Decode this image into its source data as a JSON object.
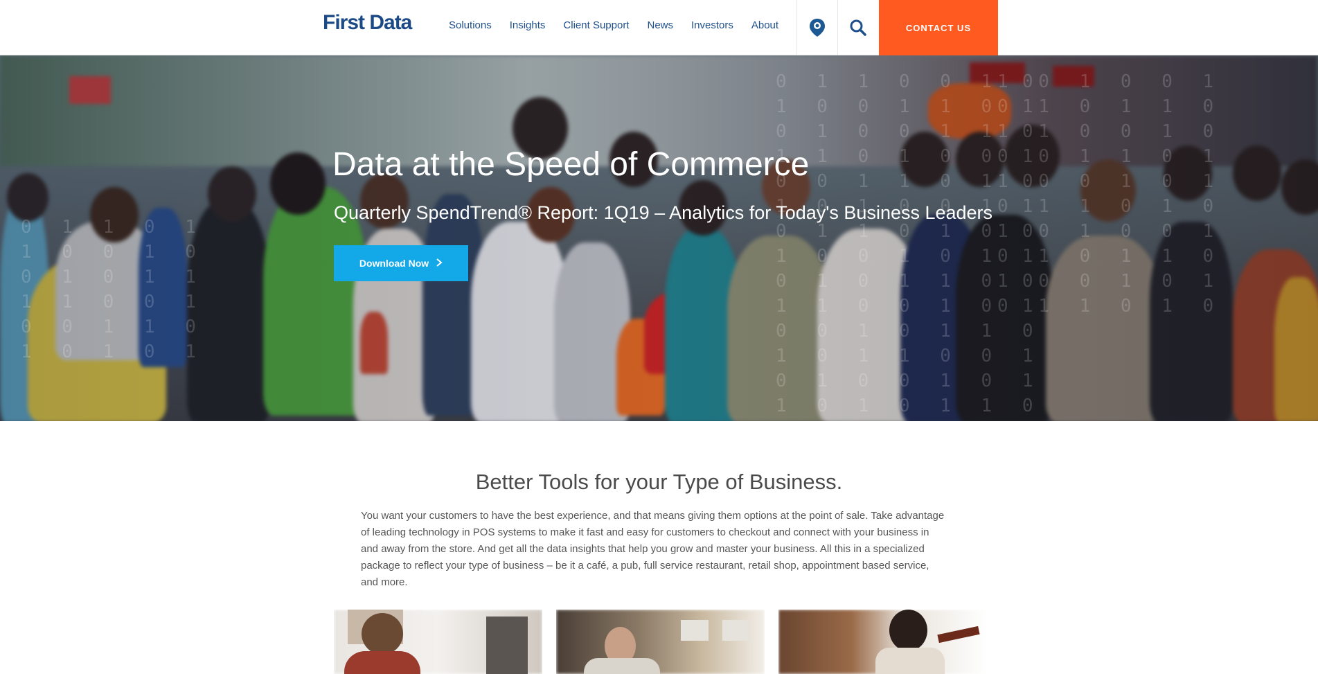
{
  "header": {
    "logo": "First Data",
    "nav": [
      "Solutions",
      "Insights",
      "Client Support",
      "News",
      "Investors",
      "About"
    ],
    "contact_label": "CONTACT US",
    "location_icon": "location-pin-icon",
    "search_icon": "search-icon"
  },
  "hero": {
    "title": "Data at the Speed of Commerce",
    "subtitle": "Quarterly SpendTrend® Report: 1Q19 – Analytics for Today's Business Leaders",
    "button_label": "Download Now",
    "button_icon": "arrow-right-icon"
  },
  "section": {
    "title": "Better Tools for your Type of Business.",
    "body": "You want your customers to have the best experience, and that means giving them options at the point of sale. Take advantage of leading technology in POS systems to make it fast and easy for customers to checkout and connect with your business in and away from the store. And get all the data insights that help you grow and master your business. All this in a specialized package to reflect your type of business – be it a café, a pub, full service restaurant, retail shop, appointment based service, and more."
  },
  "colors": {
    "brand_blue": "#1b4a86",
    "contact_orange": "#ff5a1f",
    "button_blue": "#13a8e8"
  }
}
